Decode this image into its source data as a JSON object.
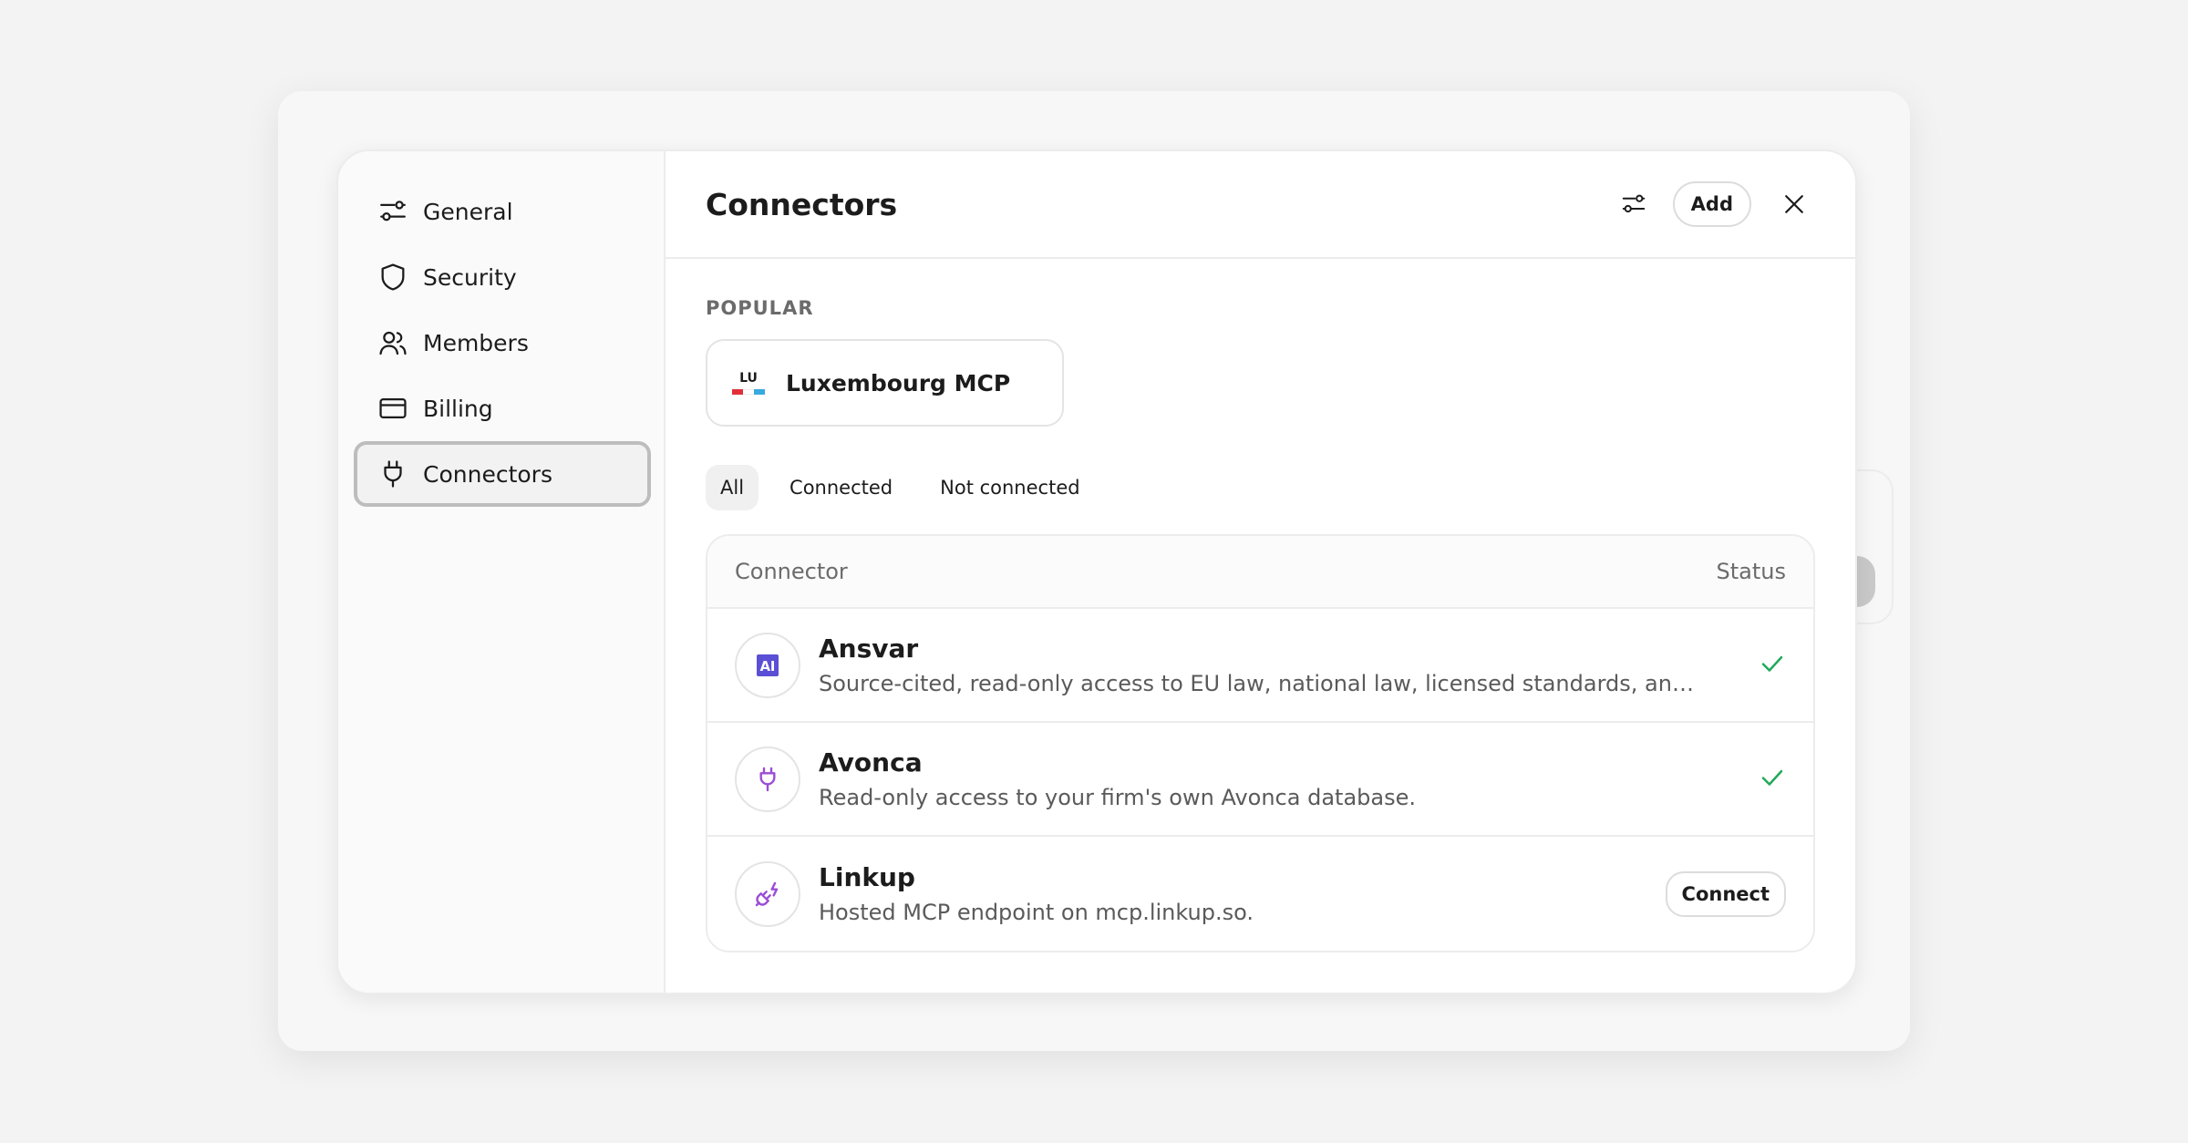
{
  "sidebar": {
    "items": [
      {
        "label": "General",
        "icon": "sliders-icon"
      },
      {
        "label": "Security",
        "icon": "shield-icon"
      },
      {
        "label": "Members",
        "icon": "users-icon"
      },
      {
        "label": "Billing",
        "icon": "credit-card-icon"
      },
      {
        "label": "Connectors",
        "icon": "plug-icon",
        "active": true
      }
    ]
  },
  "header": {
    "title": "Connectors",
    "add_label": "Add"
  },
  "popular": {
    "label": "POPULAR",
    "items": [
      {
        "name": "Luxembourg MCP",
        "logo_text": "LU"
      }
    ]
  },
  "filters": {
    "tabs": [
      {
        "label": "All",
        "active": true
      },
      {
        "label": "Connected"
      },
      {
        "label": "Not connected"
      }
    ]
  },
  "table": {
    "columns": {
      "connector": "Connector",
      "status": "Status"
    },
    "rows": [
      {
        "name": "Ansvar",
        "description": "Source-cited, read-only access to EU law, national law, licensed standards, and security frameworks.",
        "status": "connected",
        "icon": "ai-icon"
      },
      {
        "name": "Avonca",
        "description": "Read-only access to your firm's own Avonca database.",
        "status": "connected",
        "icon": "plug-icon"
      },
      {
        "name": "Linkup",
        "description": "Hosted MCP endpoint on mcp.linkup.so.",
        "status": "not-connected",
        "connect_label": "Connect",
        "icon": "plug-zap-icon"
      }
    ]
  },
  "colors": {
    "accent_purple": "#9b4dd6",
    "check_green": "#22a85a",
    "lu_red": "#e0303a",
    "lu_blue": "#39a9e0"
  }
}
